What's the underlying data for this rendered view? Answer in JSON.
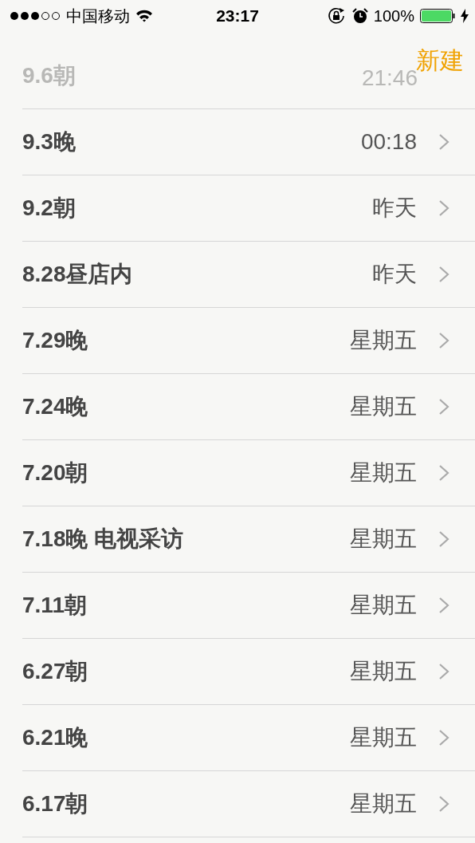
{
  "status_bar": {
    "carrier": "中国移动",
    "time": "23:17",
    "battery": "100%"
  },
  "nav": {
    "new_button": "新建"
  },
  "notes": [
    {
      "title": "9.6朝",
      "time": "21:46",
      "obscured": true
    },
    {
      "title": "9.3晚",
      "time": "00:18",
      "obscured": false
    },
    {
      "title": "9.2朝",
      "time": "昨天",
      "obscured": false
    },
    {
      "title": "8.28昼店内",
      "time": "昨天",
      "obscured": false
    },
    {
      "title": "7.29晚",
      "time": "星期五",
      "obscured": false
    },
    {
      "title": "7.24晚",
      "time": "星期五",
      "obscured": false
    },
    {
      "title": "7.20朝",
      "time": "星期五",
      "obscured": false
    },
    {
      "title": "7.18晚 电视采访",
      "time": "星期五",
      "obscured": false
    },
    {
      "title": "7.11朝",
      "time": "星期五",
      "obscured": false
    },
    {
      "title": "6.27朝",
      "time": "星期五",
      "obscured": false
    },
    {
      "title": "6.21晚",
      "time": "星期五",
      "obscured": false
    },
    {
      "title": "6.17朝",
      "time": "星期五",
      "obscured": false
    }
  ]
}
